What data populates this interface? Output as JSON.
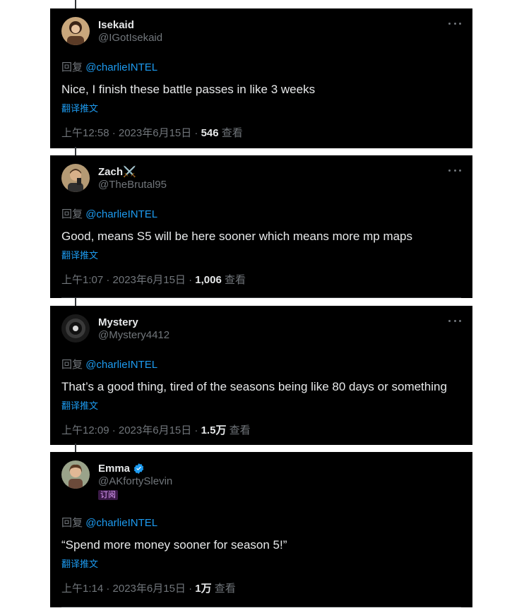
{
  "colors": {
    "background": "#000000",
    "text": "#e7e9ea",
    "secondary": "#71767b",
    "link": "#1d9bf0",
    "verified": "#1d9bf0"
  },
  "tweets": [
    {
      "display_name": "Isekaid",
      "handle": "@IGotIsekaid",
      "reply_prefix": "回复",
      "reply_mention": "@charlieINTEL",
      "text": "Nice, I finish these battle passes in like 3 weeks",
      "translate_label": "翻译推文",
      "time": "上午12:58 · 2023年6月15日 · ",
      "views_count": "546",
      "views_label": "查看"
    },
    {
      "display_name": "Zach⚔️",
      "handle": "@TheBrutal95",
      "reply_prefix": "回复",
      "reply_mention": "@charlieINTEL",
      "text": "Good, means S5 will be here sooner which means more mp maps",
      "translate_label": "翻译推文",
      "time": "上午1:07 · 2023年6月15日 · ",
      "views_count": "1,006",
      "views_label": "查看"
    },
    {
      "display_name": "Mystery",
      "handle": "@Mystery4412",
      "reply_prefix": "回复",
      "reply_mention": "@charlieINTEL",
      "text": "That’s a good thing, tired of the seasons being like 80 days or something",
      "translate_label": "翻译推文",
      "time": "上午12:09 · 2023年6月15日 · ",
      "views_count": "1.5万",
      "views_label": "查看"
    },
    {
      "display_name": "Emma",
      "handle": "@AKfortySlevin",
      "badge": "订阅",
      "reply_prefix": "回复",
      "reply_mention": "@charlieINTEL",
      "text": "“Spend more money sooner for season 5!”",
      "translate_label": "翻译推文",
      "time": "上午1:14 · 2023年6月15日 · ",
      "views_count": "1万",
      "views_label": "查看"
    }
  ]
}
